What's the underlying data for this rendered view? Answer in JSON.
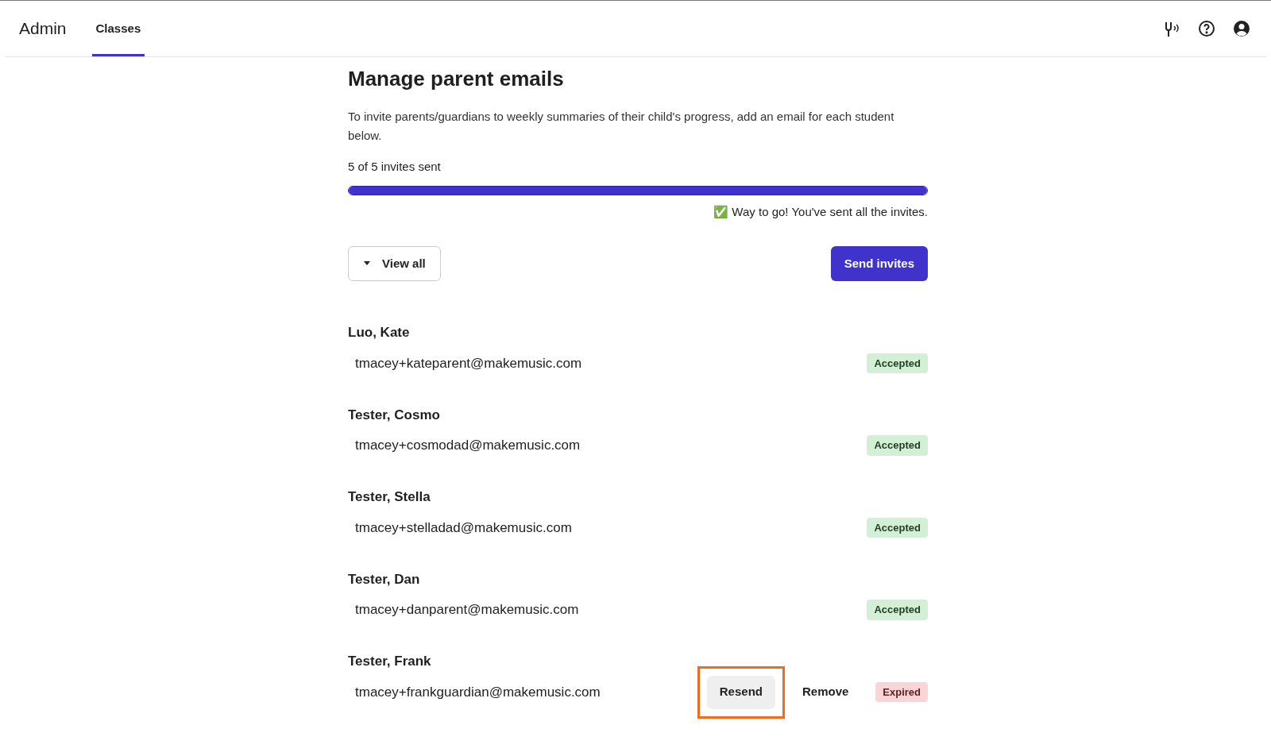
{
  "header": {
    "title": "Admin",
    "tabs": [
      {
        "label": "Classes",
        "selected": true
      }
    ]
  },
  "page": {
    "title": "Manage parent emails",
    "description": "To invite parents/guardians to weekly summaries of their child's progress, add an email for each student below.",
    "progress_label": "5 of 5 invites sent",
    "progress": {
      "level": 1
    },
    "success_message": "✅ Way to go! You've sent all the invites.",
    "view_button": "View all",
    "send_button": "Send invites"
  },
  "students": [
    {
      "name": "Luo, Kate",
      "email": "tmacey+kateparent@makemusic.com",
      "status": {
        "label": "Accepted",
        "kind": "accepted"
      }
    },
    {
      "name": "Tester, Cosmo",
      "email": "tmacey+cosmodad@makemusic.com",
      "status": {
        "label": "Accepted",
        "kind": "accepted"
      }
    },
    {
      "name": "Tester, Stella",
      "email": "tmacey+stelladad@makemusic.com",
      "status": {
        "label": "Accepted",
        "kind": "accepted"
      }
    },
    {
      "name": "Tester, Dan",
      "email": "tmacey+danparent@makemusic.com",
      "status": {
        "label": "Accepted",
        "kind": "accepted"
      }
    },
    {
      "name": "Tester, Frank",
      "email": "tmacey+frankguardian@makemusic.com",
      "status": {
        "label": "Expired",
        "kind": "expired"
      },
      "actions": [
        {
          "label": "Resend",
          "kind": "filled",
          "highlighted": true
        },
        {
          "label": "Remove",
          "kind": "plain",
          "highlighted": false
        }
      ]
    }
  ]
}
